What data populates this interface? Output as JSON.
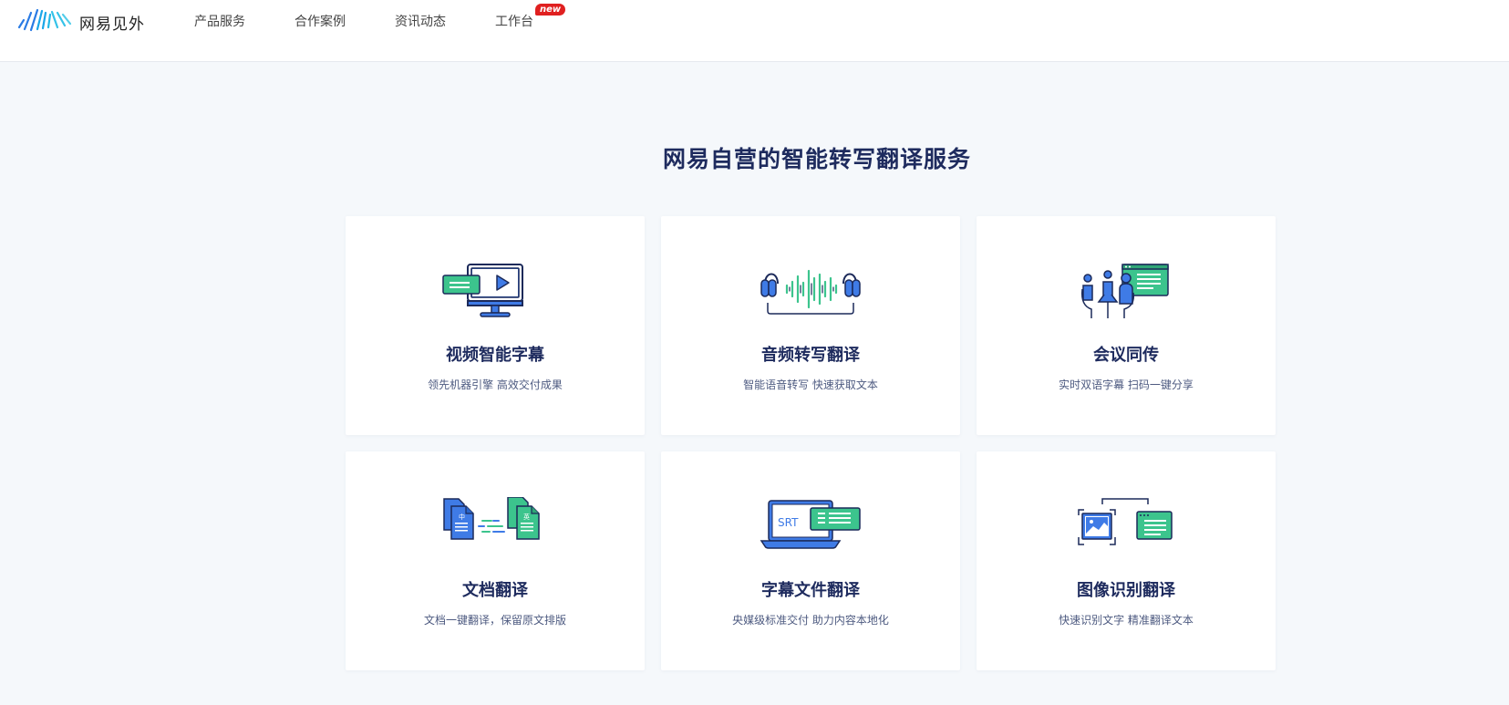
{
  "brand": {
    "name": "网易见外",
    "logo_icon": "wave-logo-icon"
  },
  "nav": [
    {
      "label": "产品服务"
    },
    {
      "label": "合作案例"
    },
    {
      "label": "资讯动态"
    },
    {
      "label": "工作台",
      "badge": "new"
    }
  ],
  "section": {
    "title": "网易自营的智能转写翻译服务"
  },
  "cards": [
    {
      "title": "视频智能字幕",
      "desc": "领先机器引擎 高效交付成果",
      "icon": "video-monitor-icon"
    },
    {
      "title": "音频转写翻译",
      "desc": "智能语音转写 快速获取文本",
      "icon": "headphones-waveform-icon"
    },
    {
      "title": "会议同传",
      "desc": "实时双语字幕 扫码一键分享",
      "icon": "meeting-presentation-icon"
    },
    {
      "title": "文档翻译",
      "desc": "文档一键翻译，保留原文排版",
      "icon": "document-translate-icon",
      "icon_text": [
        "中",
        "英"
      ]
    },
    {
      "title": "字幕文件翻译",
      "desc": "央媒级标准交付 助力内容本地化",
      "icon": "srt-laptop-icon",
      "icon_text": [
        "SRT"
      ]
    },
    {
      "title": "图像识别翻译",
      "desc": "快速识别文字 精准翻译文本",
      "icon": "image-ocr-icon"
    }
  ],
  "colors": {
    "accent_blue": "#3f7be6",
    "accent_green": "#3cc48d",
    "title_navy": "#1e2b5e"
  }
}
